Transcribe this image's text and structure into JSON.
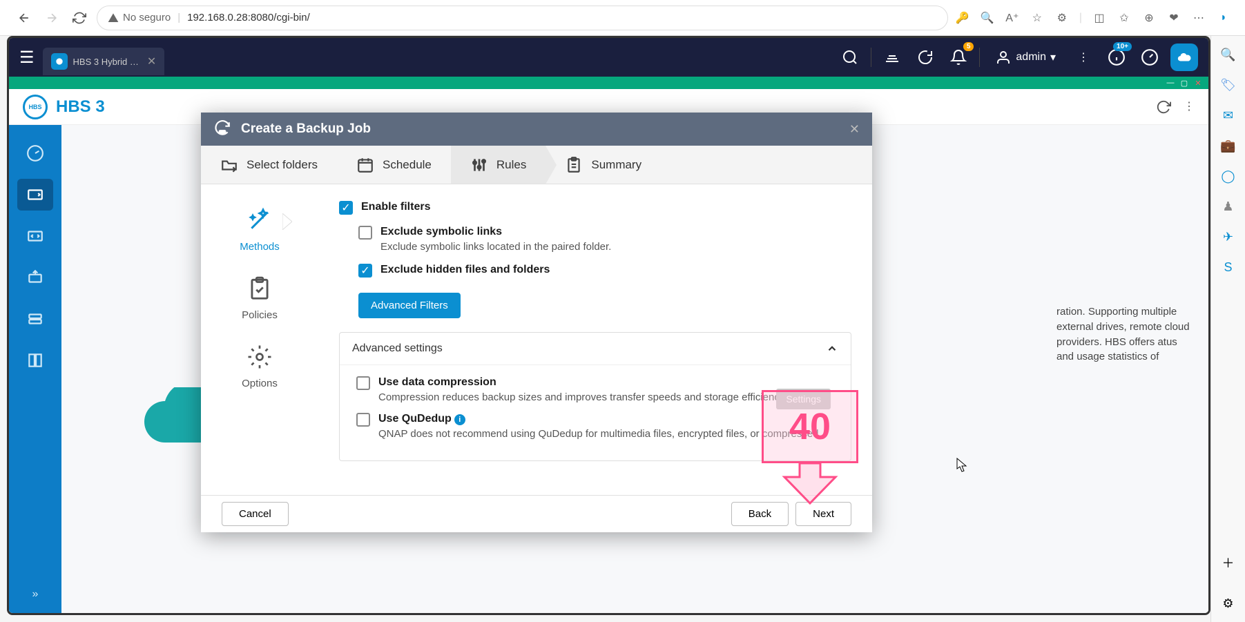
{
  "browser": {
    "secure_label": "No seguro",
    "url": "192.168.0.28:8080/cgi-bin/"
  },
  "qts": {
    "tab_title": "HBS 3 Hybrid …",
    "user": "admin",
    "notif_badge": "5",
    "help_badge": "10+"
  },
  "hbs": {
    "title": "HBS 3",
    "bg_text": "ration. Supporting multiple external drives, remote cloud providers. HBS offers atus and usage statistics of"
  },
  "modal": {
    "title": "Create a Backup Job",
    "tabs": {
      "select_folders": "Select folders",
      "schedule": "Schedule",
      "rules": "Rules",
      "summary": "Summary"
    },
    "side": {
      "methods": "Methods",
      "policies": "Policies",
      "options": "Options"
    },
    "filters": {
      "enable": "Enable filters",
      "exclude_symlinks": "Exclude symbolic links",
      "exclude_symlinks_desc": "Exclude symbolic links located in the paired folder.",
      "exclude_hidden": "Exclude hidden files and folders",
      "advanced_btn": "Advanced Filters"
    },
    "advanced": {
      "header": "Advanced settings",
      "compression": "Use data compression",
      "compression_desc": "Compression reduces backup sizes and improves transfer speeds and storage efficiency.",
      "qudedup": "Use QuDedup",
      "qudedup_desc": "QNAP does not recommend using QuDedup for multimedia files, encrypted files, or compressed",
      "settings_btn": "Settings"
    },
    "footer": {
      "cancel": "Cancel",
      "back": "Back",
      "next": "Next"
    }
  },
  "annotation": {
    "number": "40"
  }
}
